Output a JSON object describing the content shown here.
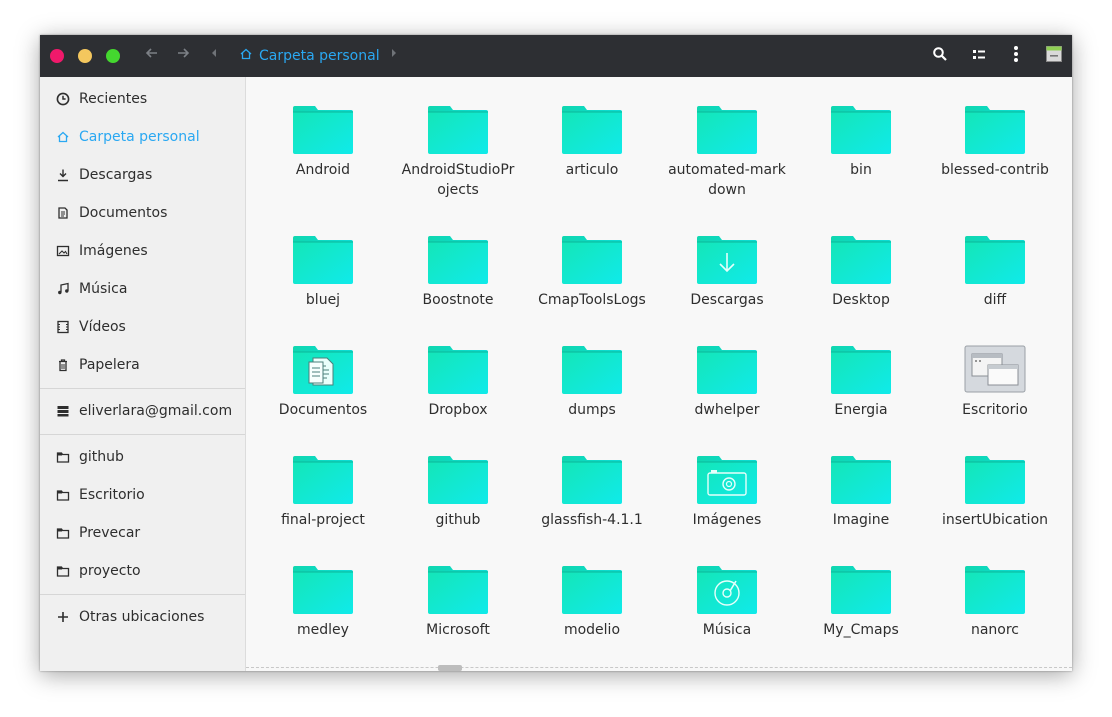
{
  "header": {
    "location_label": "Carpeta personal"
  },
  "sidebar": {
    "places": [
      {
        "label": "Recientes",
        "icon": "clock-icon"
      },
      {
        "label": "Carpeta personal",
        "icon": "home-icon",
        "active": true
      },
      {
        "label": "Descargas",
        "icon": "download-icon"
      },
      {
        "label": "Documentos",
        "icon": "document-icon"
      },
      {
        "label": "Imágenes",
        "icon": "image-icon"
      },
      {
        "label": "Música",
        "icon": "music-icon"
      },
      {
        "label": "Vídeos",
        "icon": "video-icon"
      },
      {
        "label": "Papelera",
        "icon": "trash-icon"
      }
    ],
    "account": {
      "label": "eliverlara@gmail.com",
      "icon": "server-icon"
    },
    "bookmarks": [
      {
        "label": "github",
        "icon": "folder-icon"
      },
      {
        "label": "Escritorio",
        "icon": "folder-icon"
      },
      {
        "label": "Prevecar",
        "icon": "folder-icon"
      },
      {
        "label": "proyecto",
        "icon": "folder-icon"
      }
    ],
    "other": {
      "label": "Otras ubicaciones",
      "icon": "plus-icon"
    }
  },
  "files": [
    {
      "label": "Android",
      "icon": "folder-icon"
    },
    {
      "label": "AndroidStudioProjects",
      "icon": "folder-icon"
    },
    {
      "label": "articulo",
      "icon": "folder-icon"
    },
    {
      "label": "automated-markdown",
      "icon": "folder-icon"
    },
    {
      "label": "bin",
      "icon": "folder-icon"
    },
    {
      "label": "blessed-contrib",
      "icon": "folder-icon"
    },
    {
      "label": "bluej",
      "icon": "folder-icon"
    },
    {
      "label": "Boostnote",
      "icon": "folder-icon"
    },
    {
      "label": "CmapToolsLogs",
      "icon": "folder-icon"
    },
    {
      "label": "Descargas",
      "icon": "folder-download-icon"
    },
    {
      "label": "Desktop",
      "icon": "folder-icon"
    },
    {
      "label": "diff",
      "icon": "folder-icon"
    },
    {
      "label": "Documentos",
      "icon": "folder-documents-icon"
    },
    {
      "label": "Dropbox",
      "icon": "folder-icon"
    },
    {
      "label": "dumps",
      "icon": "folder-icon"
    },
    {
      "label": "dwhelper",
      "icon": "folder-icon"
    },
    {
      "label": "Energia",
      "icon": "folder-icon"
    },
    {
      "label": "Escritorio",
      "icon": "desktop-folder-icon"
    },
    {
      "label": "final-project",
      "icon": "folder-icon"
    },
    {
      "label": "github",
      "icon": "folder-icon"
    },
    {
      "label": "glassfish-4.1.1",
      "icon": "folder-icon"
    },
    {
      "label": "Imágenes",
      "icon": "folder-pictures-icon"
    },
    {
      "label": "Imagine",
      "icon": "folder-icon"
    },
    {
      "label": "insertUbication",
      "icon": "folder-icon"
    },
    {
      "label": "medley",
      "icon": "folder-icon"
    },
    {
      "label": "Microsoft",
      "icon": "folder-icon"
    },
    {
      "label": "modelio",
      "icon": "folder-icon"
    },
    {
      "label": "Música",
      "icon": "folder-music-icon"
    },
    {
      "label": "My_Cmaps",
      "icon": "folder-icon"
    },
    {
      "label": "nanorc",
      "icon": "folder-icon"
    }
  ],
  "colors": {
    "accent": "#2aa8f2",
    "folder_gradient_start": "#17e3c4",
    "folder_gradient_end": "#0fe8e0",
    "headerbar": "#2d2f33",
    "close": "#f0196b",
    "minimize": "#f4c75e",
    "maximize": "#44d72f"
  }
}
